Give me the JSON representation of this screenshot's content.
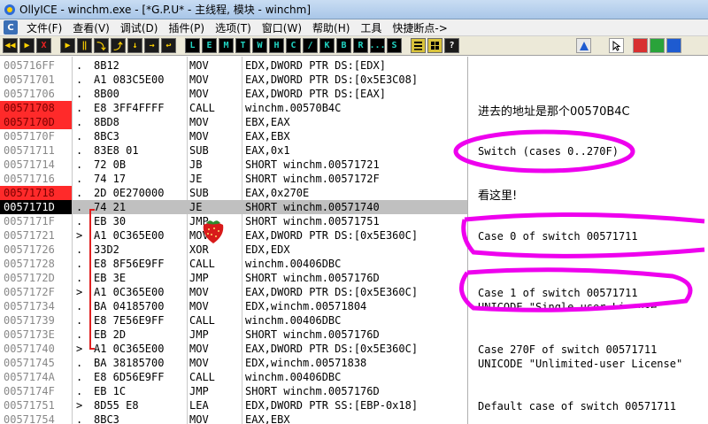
{
  "window": {
    "title": "OllyICE - winchm.exe - [*G.P.U* - 主线程, 模块 - winchm]"
  },
  "menu": {
    "app_icon": "C",
    "items": [
      "文件(F)",
      "查看(V)",
      "调试(D)",
      "插件(P)",
      "选项(T)",
      "窗口(W)",
      "帮助(H)",
      "工具",
      "快捷断点->"
    ]
  },
  "toolbar": {
    "left_buttons": [
      "◀◀",
      "▶",
      "X",
      "▶",
      "‖",
      "⤵",
      "⤴",
      "↓",
      "→",
      "↩"
    ],
    "letters": [
      "L",
      "E",
      "M",
      "T",
      "W",
      "H",
      "C",
      "/",
      "K",
      "B",
      "R",
      "...",
      "S"
    ],
    "right_icons": [
      "list-icon",
      "grid-icon",
      "question-icon",
      "font-icon",
      "cursor-icon",
      "tool-icon",
      "tool-icon-2",
      "tool-icon-3"
    ]
  },
  "disasm": [
    {
      "addr": "005716FF",
      "mark": ".",
      "hex": "8B12",
      "mn": "MOV",
      "op": "EDX,DWORD PTR DS:[EDX]",
      "style": ""
    },
    {
      "addr": "00571701",
      "mark": ".",
      "hex": "A1 083C5E00",
      "mn": "MOV",
      "op": "EAX,DWORD PTR DS:[0x5E3C08]",
      "style": ""
    },
    {
      "addr": "00571706",
      "mark": ".",
      "hex": "8B00",
      "mn": "MOV",
      "op": "EAX,DWORD PTR DS:[EAX]",
      "style": ""
    },
    {
      "addr": "00571708",
      "mark": ".",
      "hex": "E8 3FF4FFFF",
      "mn": "CALL",
      "op": "winchm.00570B4C",
      "style": "hl"
    },
    {
      "addr": "0057170D",
      "mark": ".",
      "hex": "8BD8",
      "mn": "MOV",
      "op": "EBX,EAX",
      "style": "hl"
    },
    {
      "addr": "0057170F",
      "mark": ".",
      "hex": "8BC3",
      "mn": "MOV",
      "op": "EAX,EBX",
      "style": ""
    },
    {
      "addr": "00571711",
      "mark": ".",
      "hex": "83E8 01",
      "mn": "SUB",
      "op": "EAX,0x1",
      "style": ""
    },
    {
      "addr": "00571714",
      "mark": ".",
      "hex": "72 0B",
      "mn": "JB",
      "op": "SHORT winchm.00571721",
      "style": ""
    },
    {
      "addr": "00571716",
      "mark": ".",
      "hex": "74 17",
      "mn": "JE",
      "op": "SHORT winchm.0057172F",
      "style": ""
    },
    {
      "addr": "00571718",
      "mark": ".",
      "hex": "2D 0E270000",
      "mn": "SUB",
      "op": "EAX,0x270E",
      "style": "hl"
    },
    {
      "addr": "0057171D",
      "mark": ".",
      "hex": "74 21",
      "mn": "JE",
      "op": "SHORT winchm.00571740",
      "style": "cur"
    },
    {
      "addr": "0057171F",
      "mark": ".",
      "hex": "EB 30",
      "mn": "JMP",
      "op": "SHORT winchm.00571751",
      "style": ""
    },
    {
      "addr": "00571721",
      "mark": ">",
      "hex": "A1 0C365E00",
      "mn": "MOV",
      "op": "EAX,DWORD PTR DS:[0x5E360C]",
      "style": ""
    },
    {
      "addr": "00571726",
      "mark": ".",
      "hex": "33D2",
      "mn": "XOR",
      "op": "EDX,EDX",
      "style": ""
    },
    {
      "addr": "00571728",
      "mark": ".",
      "hex": "E8 8F56E9FF",
      "mn": "CALL",
      "op": "winchm.00406DBC",
      "style": ""
    },
    {
      "addr": "0057172D",
      "mark": ".",
      "hex": "EB 3E",
      "mn": "JMP",
      "op": "SHORT winchm.0057176D",
      "style": ""
    },
    {
      "addr": "0057172F",
      "mark": ">",
      "hex": "A1 0C365E00",
      "mn": "MOV",
      "op": "EAX,DWORD PTR DS:[0x5E360C]",
      "style": ""
    },
    {
      "addr": "00571734",
      "mark": ".",
      "hex": "BA 04185700",
      "mn": "MOV",
      "op": "EDX,winchm.00571804",
      "style": ""
    },
    {
      "addr": "00571739",
      "mark": ".",
      "hex": "E8 7E56E9FF",
      "mn": "CALL",
      "op": "winchm.00406DBC",
      "style": ""
    },
    {
      "addr": "0057173E",
      "mark": ".",
      "hex": "EB 2D",
      "mn": "JMP",
      "op": "SHORT winchm.0057176D",
      "style": ""
    },
    {
      "addr": "00571740",
      "mark": ">",
      "hex": "A1 0C365E00",
      "mn": "MOV",
      "op": "EAX,DWORD PTR DS:[0x5E360C]",
      "style": ""
    },
    {
      "addr": "00571745",
      "mark": ".",
      "hex": "BA 38185700",
      "mn": "MOV",
      "op": "EDX,winchm.00571838",
      "style": ""
    },
    {
      "addr": "0057174A",
      "mark": ".",
      "hex": "E8 6D56E9FF",
      "mn": "CALL",
      "op": "winchm.00406DBC",
      "style": ""
    },
    {
      "addr": "0057174F",
      "mark": ".",
      "hex": "EB 1C",
      "mn": "JMP",
      "op": "SHORT winchm.0057176D",
      "style": ""
    },
    {
      "addr": "00571751",
      "mark": ">",
      "hex": "8D55 E8",
      "mn": "LEA",
      "op": "EDX,DWORD PTR SS:[EBP-0x18]",
      "style": ""
    },
    {
      "addr": "00571754",
      "mark": ".",
      "hex": "8BC3",
      "mn": "MOV",
      "op": "EAX,EBX",
      "style": ""
    }
  ],
  "comments": {
    "c1": "进去的地址是那个00570B4C",
    "c2": "Switch (cases 0..270F)",
    "c3": "看这里!",
    "c4": "Case 0 of switch 00571711",
    "c5": "Case 1 of switch 00571711",
    "c5b": "UNICODE \"Single-user License\"",
    "c6": "Case 270F of switch 00571711",
    "c7": "UNICODE \"Unlimited-user License\"",
    "c8": "Default case of switch 00571711"
  },
  "colors": {
    "highlight": "#ff2a2a",
    "selection": "#c0c0c0",
    "annotation": "#ee00ee",
    "jump": "#e02020"
  }
}
